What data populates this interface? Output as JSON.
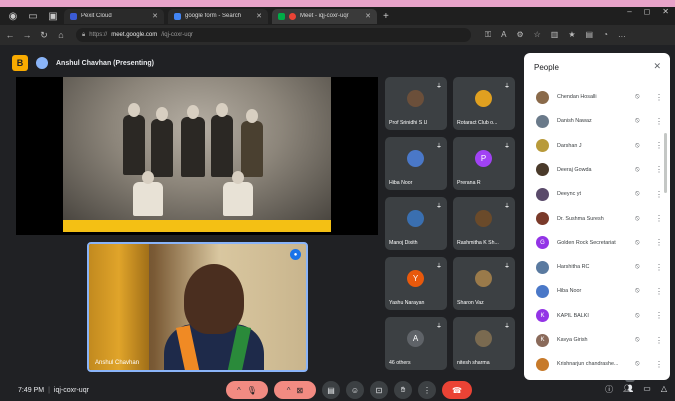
{
  "browser": {
    "tabs": [
      {
        "label": "Pexit Cloud",
        "favicon_color": "#3b5bd6",
        "active": false
      },
      {
        "label": "google form - Search",
        "favicon_color": "#4285f4",
        "active": false
      },
      {
        "label": "Meet - iqj-coxr-uqr",
        "favicon_color": "#00ac47",
        "active": true
      }
    ],
    "new_tab": "+",
    "url_prefix": "https://",
    "url_host": "meet.google.com",
    "url_path": "/iqj-coxr-uqr"
  },
  "meet": {
    "presenter_label": "Anshul Chavhan (Presenting)",
    "self_view_name": "Anshul Chavhan",
    "time": "7:49 PM",
    "meeting_code": "iqj-coxr-uqr",
    "participant_count_badge": "47",
    "tiles": [
      {
        "name": "Prof Srinidhi S U",
        "avatar_letter": "",
        "avatar_color": "#6b4f3a"
      },
      {
        "name": "Rotaract Club o...",
        "avatar_letter": "",
        "avatar_color": "#e0a020"
      },
      {
        "name": "Hiba Noor",
        "avatar_letter": "",
        "avatar_color": "#4a78c8"
      },
      {
        "name": "Prerana R",
        "avatar_letter": "P",
        "avatar_color": "#a142f4"
      },
      {
        "name": "Manoj Dixith",
        "avatar_letter": "",
        "avatar_color": "#3a6fb0"
      },
      {
        "name": "Rashmitha K Sh...",
        "avatar_letter": "",
        "avatar_color": "#6a4a2a"
      },
      {
        "name": "Yashu Narayan",
        "avatar_letter": "Y",
        "avatar_color": "#e8590c"
      },
      {
        "name": "Sharon Vaz",
        "avatar_letter": "",
        "avatar_color": "#9a7a4a"
      },
      {
        "name": "46 others",
        "avatar_letter": "A",
        "avatar_color": "#5f6368"
      },
      {
        "name": "nitesh sharma",
        "avatar_letter": "",
        "avatar_color": "#7a6a50"
      }
    ]
  },
  "people_panel": {
    "title": "People",
    "participants": [
      {
        "name": "Chendan Hosalli",
        "letter": "",
        "color": "#8a6a4a"
      },
      {
        "name": "Danish Nawaz",
        "letter": "",
        "color": "#6a7a8a"
      },
      {
        "name": "Darshan J",
        "letter": "",
        "color": "#b89a3a"
      },
      {
        "name": "Deeraj Gowda",
        "letter": "",
        "color": "#4a3a2a"
      },
      {
        "name": "Deeync yt",
        "letter": "",
        "color": "#5a4a6a"
      },
      {
        "name": "Dr. Sushma Suresh",
        "letter": "",
        "color": "#7a3a2a"
      },
      {
        "name": "Golden Rock Secretariat",
        "letter": "G",
        "color": "#9334e6"
      },
      {
        "name": "Harshitha RC",
        "letter": "",
        "color": "#5a7aa0"
      },
      {
        "name": "Hiba Noor",
        "letter": "",
        "color": "#4a78c8"
      },
      {
        "name": "KAPIL BALKI",
        "letter": "K",
        "color": "#9334e6"
      },
      {
        "name": "Kavya Girish",
        "letter": "K",
        "color": "#8a6a5a"
      },
      {
        "name": "Krishnarjun chandrashe...",
        "letter": "",
        "color": "#c77a2a"
      }
    ]
  }
}
